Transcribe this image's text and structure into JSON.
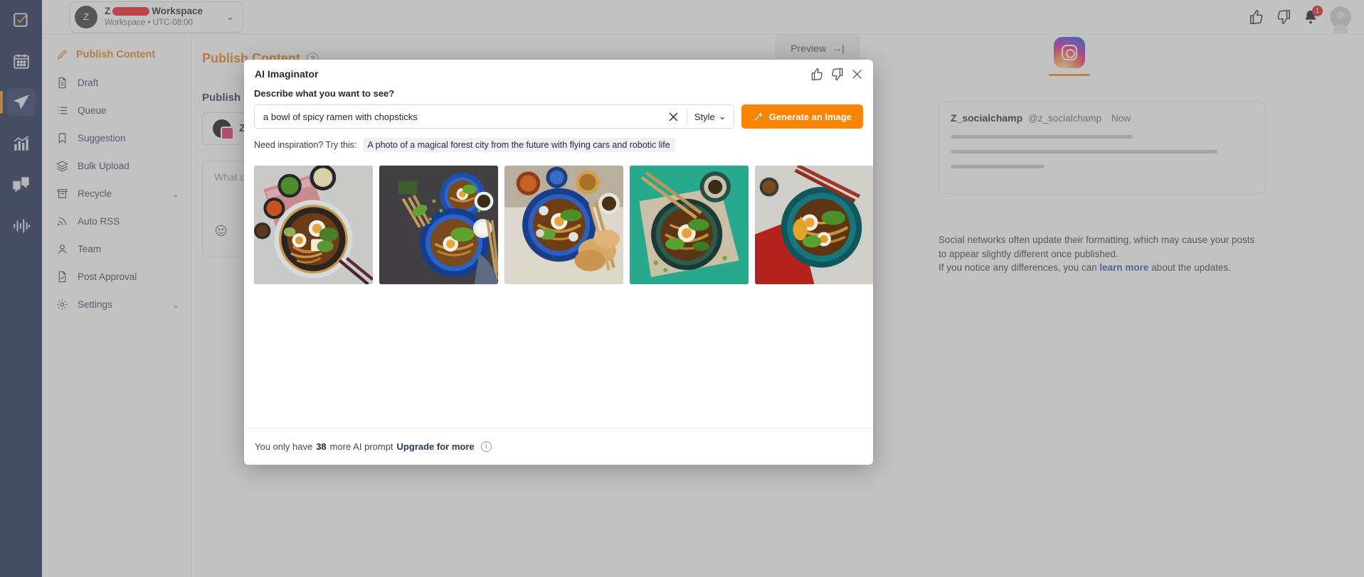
{
  "rail": {
    "items": [
      {
        "name": "tasks",
        "icon": "checkbox-icon"
      },
      {
        "name": "calendar",
        "icon": "calendar-icon"
      },
      {
        "name": "publish",
        "icon": "send-icon",
        "active": true
      },
      {
        "name": "analytics",
        "icon": "analytics-icon"
      },
      {
        "name": "inbox",
        "icon": "chat-icon"
      },
      {
        "name": "monitor",
        "icon": "waveform-icon"
      }
    ]
  },
  "topbar": {
    "workspace_initial": "Z",
    "workspace_name_suffix": "Workspace",
    "workspace_sub": "Workspace • UTC-08:00",
    "chevron": "⌄",
    "notification_count": "1"
  },
  "sidebar": {
    "header": "Publish Content",
    "items": [
      {
        "label": "Draft",
        "icon": "document-icon",
        "expandable": false
      },
      {
        "label": "Queue",
        "icon": "list-icon",
        "expandable": false
      },
      {
        "label": "Suggestion",
        "icon": "bookmark-icon",
        "expandable": false
      },
      {
        "label": "Bulk Upload",
        "icon": "layers-icon",
        "expandable": false
      },
      {
        "label": "Recycle",
        "icon": "archive-icon",
        "expandable": true
      },
      {
        "label": "Auto RSS",
        "icon": "rss-icon",
        "expandable": false
      },
      {
        "label": "Team",
        "icon": "user-icon",
        "expandable": false
      },
      {
        "label": "Post Approval",
        "icon": "doc-check-icon",
        "expandable": false
      },
      {
        "label": "Settings",
        "icon": "gear-icon",
        "expandable": true
      }
    ],
    "caret": "⌄"
  },
  "main": {
    "title": "Publish Content",
    "help": "?",
    "publish_to_label": "Publish to",
    "account_name": "Z_socialchamp",
    "composer_placeholder": "What do you want to share?",
    "preview_tab": "Preview",
    "preview_arrow": "→|",
    "preview": {
      "name": "Z_socialchamp",
      "handle": "@z_socialchamp",
      "time": "Now"
    },
    "notice_line1": "Social networks often update their formatting, which may cause your posts",
    "notice_line2": "to appear slightly different once published.",
    "notice_line3_pre": "If you notice any differences, you can ",
    "notice_link": "learn more",
    "notice_line3_post": " about the updates."
  },
  "modal": {
    "title": "AI Imaginator",
    "thumbs_up_icon": "thumbs-up-icon",
    "thumbs_down_icon": "thumbs-down-icon",
    "close_icon": "close-icon",
    "field_label": "Describe what you want to see?",
    "prompt_value": "a bowl of spicy ramen with chopsticks",
    "prompt_placeholder": "Describe what you want to see?",
    "clear_icon": "clear-icon",
    "style_label": "Style",
    "style_caret": "⌄",
    "generate_button": "Generate an Image",
    "generate_icon": "magic-wand-icon",
    "inspiration_label": "Need inspiration? Try this:",
    "inspiration_prompt": "A photo of a magical forest city from the future with flying cars and robotic life",
    "results": [
      {
        "alt": "ramen bowl on grey table with pink cloth and side dishes"
      },
      {
        "alt": "two blue ramen bowls overhead with chopsticks"
      },
      {
        "alt": "blue ramen bowl with egg and crackers on white cloth"
      },
      {
        "alt": "dark ramen bowl on green background with chopsticks"
      },
      {
        "alt": "teal ramen bowl with red napkin and chopsticks"
      }
    ],
    "footer_pre": "You only have",
    "footer_count": "38",
    "footer_mid": "more AI prompt",
    "footer_upgrade": "Upgrade for more",
    "footer_info_icon": "info-icon"
  },
  "colors": {
    "accent_orange": "#e8821e",
    "button_orange": "#f98503",
    "rail_navy": "#1f2a52",
    "link_blue": "#2b5bb5",
    "badge_red": "#d8232a"
  }
}
